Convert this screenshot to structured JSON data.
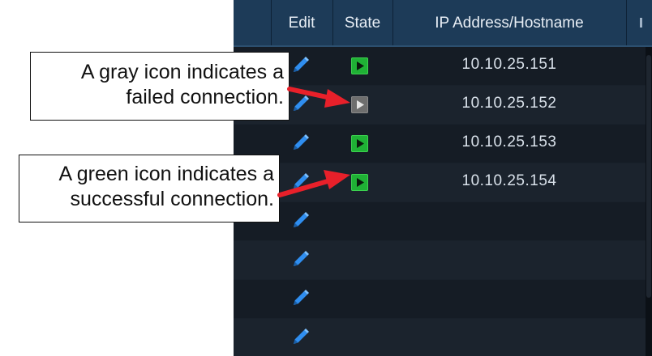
{
  "table": {
    "columns": {
      "edit": "Edit",
      "state": "State",
      "ip": "IP Address/Hostname"
    },
    "rows": [
      {
        "state": "green",
        "ip": "10.10.25.151"
      },
      {
        "state": "gray",
        "ip": "10.10.25.152"
      },
      {
        "state": "green",
        "ip": "10.10.25.153"
      },
      {
        "state": "green",
        "ip": "10.10.25.154"
      },
      {
        "state": "none",
        "ip": ""
      },
      {
        "state": "none",
        "ip": ""
      },
      {
        "state": "none",
        "ip": ""
      },
      {
        "state": "none",
        "ip": ""
      }
    ]
  },
  "callouts": {
    "gray": {
      "line1": "A gray icon indicates a",
      "line2": "failed connection."
    },
    "green": {
      "line1": "A green icon indicates a",
      "line2": "successful connection."
    }
  },
  "colors": {
    "connected": "#1fb135",
    "failed": "#6e6e6e",
    "pencil": "#2f8ef0",
    "arrow": "#e8202a",
    "header_bg": "#1d3b58"
  },
  "icons": {
    "edit": "pencil-icon",
    "state": "play-icon"
  }
}
